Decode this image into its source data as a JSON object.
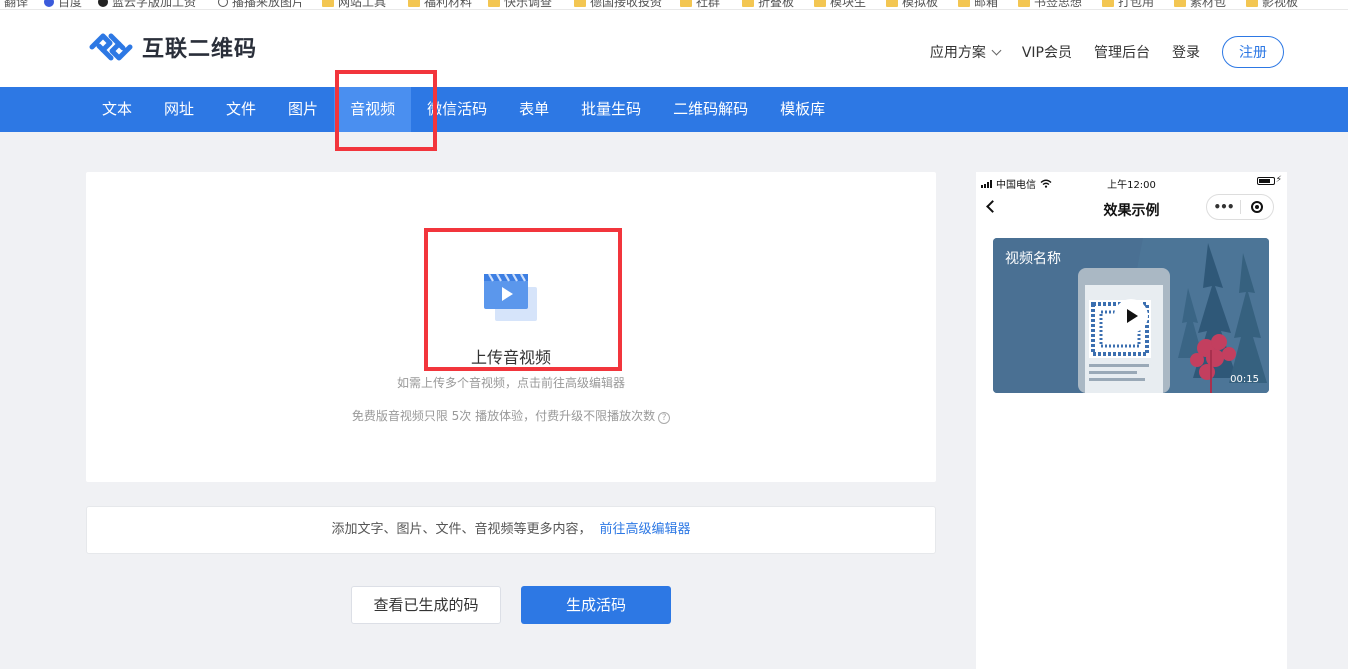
{
  "bookmarks": [
    "翻译",
    "百度",
    "蓝云字版加工资",
    "播播来放图片",
    "网站工具",
    "福利材料",
    "快乐调查",
    "德国接收投资",
    "社群",
    "折叠板",
    "模块生",
    "模拟板",
    "邮箱",
    "书签思想",
    "打包用",
    "素材包",
    "影视板"
  ],
  "header": {
    "logo_text": "互联二维码",
    "nav": {
      "solutions": "应用方案",
      "vip": "VIP会员",
      "admin": "管理后台",
      "login": "登录",
      "register": "注册"
    }
  },
  "tabs": [
    "文本",
    "网址",
    "文件",
    "图片",
    "音视频",
    "微信活码",
    "表单",
    "批量生码",
    "二维码解码",
    "模板库"
  ],
  "active_tab": "音视频",
  "upload": {
    "title": "上传音视频",
    "hint": "如需上传多个音视频，点击前往高级编辑器",
    "note": "免费版音视频只限 5次 播放体验，付费升级不限播放次数",
    "help_icon": "question-circle-icon"
  },
  "add_bar": {
    "text": "添加文字、图片、文件、音视频等更多内容，",
    "link": "前往高级编辑器"
  },
  "buttons": {
    "view_generated": "查看已生成的码",
    "generate": "生成活码"
  },
  "phone": {
    "carrier": "中国电信",
    "time": "上午12:00",
    "title": "效果示例",
    "more": "•••",
    "video_name": "视频名称",
    "duration": "00:15"
  },
  "colors": {
    "primary": "#2d78e4",
    "highlight": "#f2353c",
    "background": "#f0f1f4"
  }
}
